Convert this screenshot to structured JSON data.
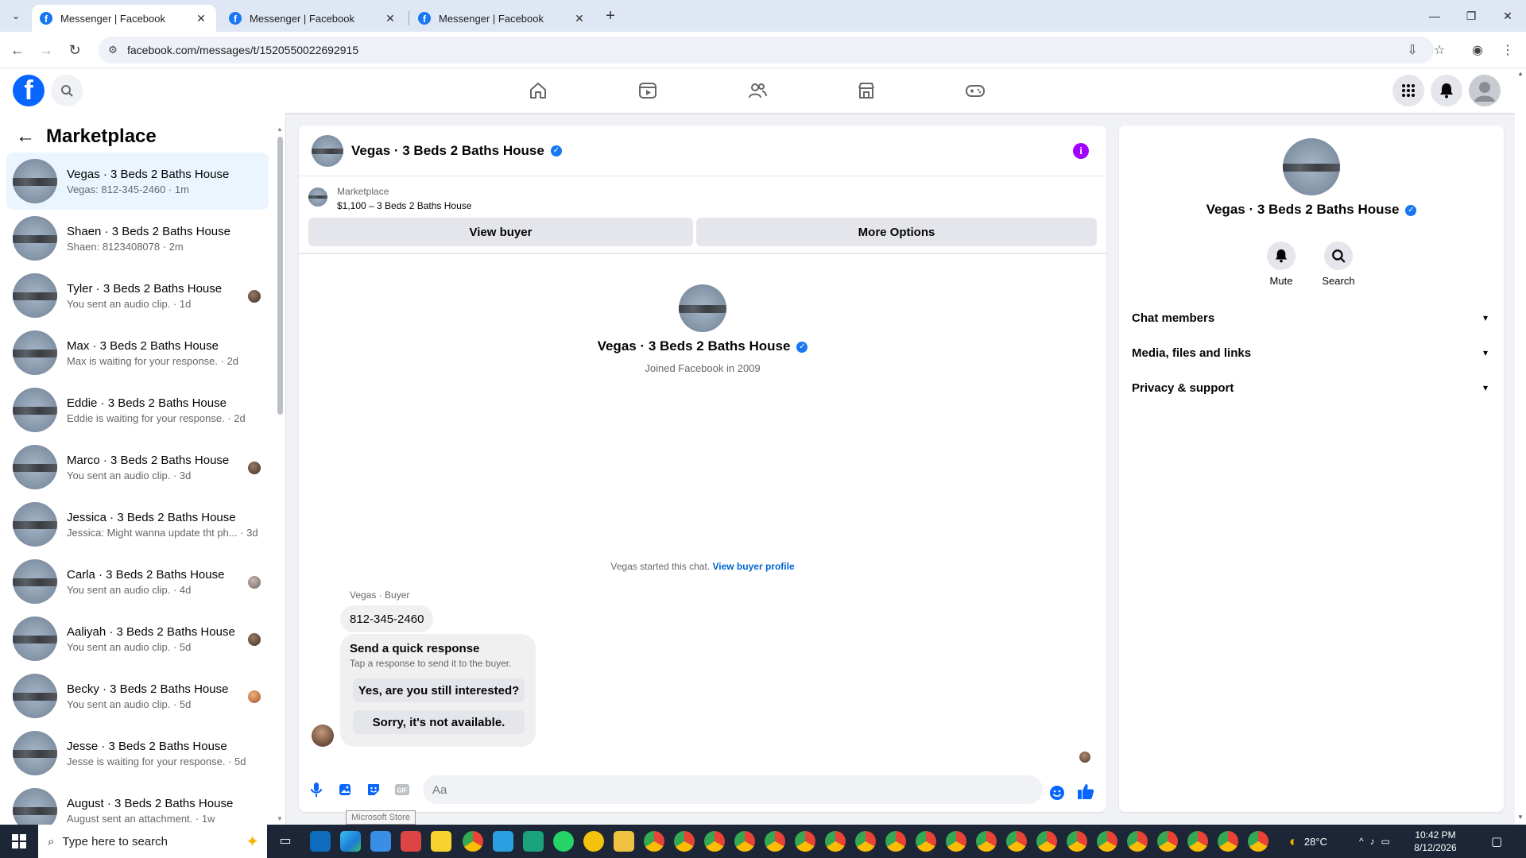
{
  "browser": {
    "tabs": [
      {
        "title": "Messenger | Facebook",
        "active": true
      },
      {
        "title": "Messenger | Facebook",
        "active": false
      },
      {
        "title": "Messenger | Facebook",
        "active": false
      }
    ],
    "url": "facebook.com/messages/t/1520550022692915"
  },
  "colors": {
    "facebook_blue": "#0866ff",
    "link_blue": "#0064d1",
    "info_purple": "#a200ff",
    "active_conversation_bg": "#ebf5ff"
  },
  "left_panel": {
    "title": "Marketplace",
    "conversations": [
      {
        "name": "Vegas · 3 Beds 2 Baths House",
        "preview": "Vegas: 812-345-2460 · 1m",
        "active": true
      },
      {
        "name": "Shaen · 3 Beds 2 Baths House",
        "preview": "Shaen: 8123408078 · 2m"
      },
      {
        "name": "Tyler · 3 Beds 2 Baths House",
        "preview": "You sent an audio clip. · 1d"
      },
      {
        "name": "Max · 3 Beds 2 Baths House",
        "preview": "Max is waiting for your response. · 2d"
      },
      {
        "name": "Eddie · 3 Beds 2 Baths House",
        "preview": "Eddie is waiting for your response. · 2d"
      },
      {
        "name": "Marco · 3 Beds 2 Baths House",
        "preview": "You sent an audio clip. · 3d"
      },
      {
        "name": "Jessica · 3 Beds 2 Baths House",
        "preview": "Jessica: Might wanna update tht ph... · 3d"
      },
      {
        "name": "Carla · 3 Beds 2 Baths House",
        "preview": "You sent an audio clip. · 4d"
      },
      {
        "name": "Aaliyah · 3 Beds 2 Baths House",
        "preview": "You sent an audio clip. · 5d"
      },
      {
        "name": "Becky · 3 Beds 2 Baths House",
        "preview": "You sent an audio clip. · 5d"
      },
      {
        "name": "Jesse · 3 Beds 2 Baths House",
        "preview": "Jesse is waiting for your response. · 5d"
      },
      {
        "name": "August · 3 Beds 2 Baths House",
        "preview": "August sent an attachment. · 1w"
      }
    ]
  },
  "chat": {
    "title": "Vegas · 3 Beds 2 Baths House",
    "marketplace_label": "Marketplace",
    "listing": "$1,100 – 3 Beds 2 Baths House",
    "view_buyer_label": "View buyer",
    "more_options_label": "More Options",
    "intro_name": "Vegas · 3 Beds 2 Baths House",
    "joined": "Joined Facebook in 2009",
    "started_text": "Vegas started this chat.",
    "view_buyer_profile": "View buyer profile",
    "sender_label": "Vegas · Buyer",
    "message": "812-345-2460",
    "quick_response_title": "Send a quick response",
    "quick_response_sub": "Tap a response to send it to the buyer.",
    "quick_responses": [
      "Yes, are you still interested?",
      "Sorry, it's not available."
    ],
    "input_placeholder": "Aa"
  },
  "tooltip": "Microsoft Store",
  "right_panel": {
    "name": "Vegas · 3 Beds 2 Baths House",
    "actions": [
      {
        "label": "Mute",
        "icon": "bell-icon"
      },
      {
        "label": "Search",
        "icon": "search-icon"
      }
    ],
    "sections": [
      "Chat members",
      "Media, files and links",
      "Privacy & support"
    ]
  },
  "taskbar": {
    "search_placeholder": "Type here to search",
    "temperature": "28°C",
    "time": "10:42 PM",
    "date": "8/12/2026"
  }
}
